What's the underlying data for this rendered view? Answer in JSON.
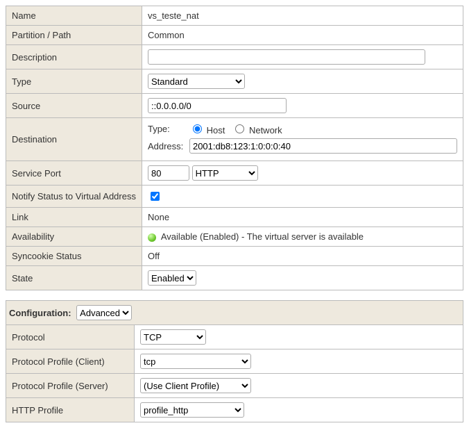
{
  "general": {
    "name_label": "Name",
    "name_value": "vs_teste_nat",
    "partition_label": "Partition / Path",
    "partition_value": "Common",
    "description_label": "Description",
    "description_value": "",
    "type_label": "Type",
    "type_value": "Standard",
    "source_label": "Source",
    "source_value": "::0.0.0.0/0",
    "destination_label": "Destination",
    "dest_type_label": "Type:",
    "dest_type_host": "Host",
    "dest_type_network": "Network",
    "dest_type_selected": "Host",
    "dest_address_label": "Address:",
    "dest_address_value": "2001:db8:123:1:0:0:0:40",
    "service_port_label": "Service Port",
    "service_port_number": "80",
    "service_port_proto": "HTTP",
    "notify_label": "Notify Status to Virtual Address",
    "notify_checked": true,
    "link_label": "Link",
    "link_value": "None",
    "availability_label": "Availability",
    "availability_value": "Available (Enabled) - The virtual server is available",
    "syncookie_label": "Syncookie Status",
    "syncookie_value": "Off",
    "state_label": "State",
    "state_value": "Enabled"
  },
  "config_section": {
    "heading": "Configuration:",
    "level": "Advanced",
    "protocol_label": "Protocol",
    "protocol_value": "TCP",
    "pp_client_label": "Protocol Profile (Client)",
    "pp_client_value": "tcp",
    "pp_server_label": "Protocol Profile (Server)",
    "pp_server_value": "(Use Client Profile)",
    "http_profile_label": "HTTP Profile",
    "http_profile_value": "profile_http"
  }
}
